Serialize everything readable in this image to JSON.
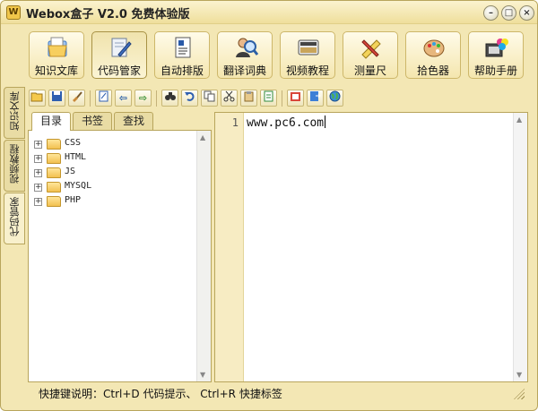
{
  "window": {
    "title": "Webox盒子 V2.0 免费体验版",
    "min_symbol": "–",
    "max_symbol": "□",
    "close_symbol": "×"
  },
  "main_toolbar": [
    {
      "label": "知识文库",
      "icon": "book-folder-icon"
    },
    {
      "label": "代码管家",
      "icon": "pen-document-icon"
    },
    {
      "label": "自动排版",
      "icon": "text-document-icon"
    },
    {
      "label": "翻译词典",
      "icon": "person-magnifier-icon"
    },
    {
      "label": "视频教程",
      "icon": "video-icon"
    },
    {
      "label": "测量尺",
      "icon": "ruler-pencil-icon"
    },
    {
      "label": "拾色器",
      "icon": "palette-icon"
    },
    {
      "label": "帮助手册",
      "icon": "help-manual-icon"
    }
  ],
  "side_tabs": [
    "知识文库",
    "视频教程",
    "代码管家"
  ],
  "small_toolbar": {
    "open": "open-folder-icon",
    "save": "save-icon",
    "clear": "brush-icon",
    "edit": "edit-icon",
    "back_arrow": "⇦",
    "forward_arrow": "⇨",
    "find": "binoculars-icon",
    "undo": "undo-icon",
    "copy": "copy-icon",
    "cut": "scissors-icon",
    "paste": "paste-icon",
    "doc": "document-icon",
    "html": "html-icon",
    "export": "export-icon",
    "web": "globe-icon"
  },
  "left_panel": {
    "tabs": [
      "目录",
      "书签",
      "查找"
    ],
    "tree": [
      {
        "expander": "+",
        "name": "CSS"
      },
      {
        "expander": "+",
        "name": "HTML"
      },
      {
        "expander": "+",
        "name": "JS"
      },
      {
        "expander": "+",
        "name": "MYSQL"
      },
      {
        "expander": "+",
        "name": "PHP"
      }
    ],
    "scroll_up": "▲",
    "scroll_down": "▼"
  },
  "editor": {
    "line_number": "1",
    "content": "www.pc6.com",
    "scroll_up": "▲",
    "scroll_down": "▼"
  },
  "status_bar": {
    "text": "快捷键说明：Ctrl+D 代码提示、 Ctrl+R 快捷标签"
  }
}
